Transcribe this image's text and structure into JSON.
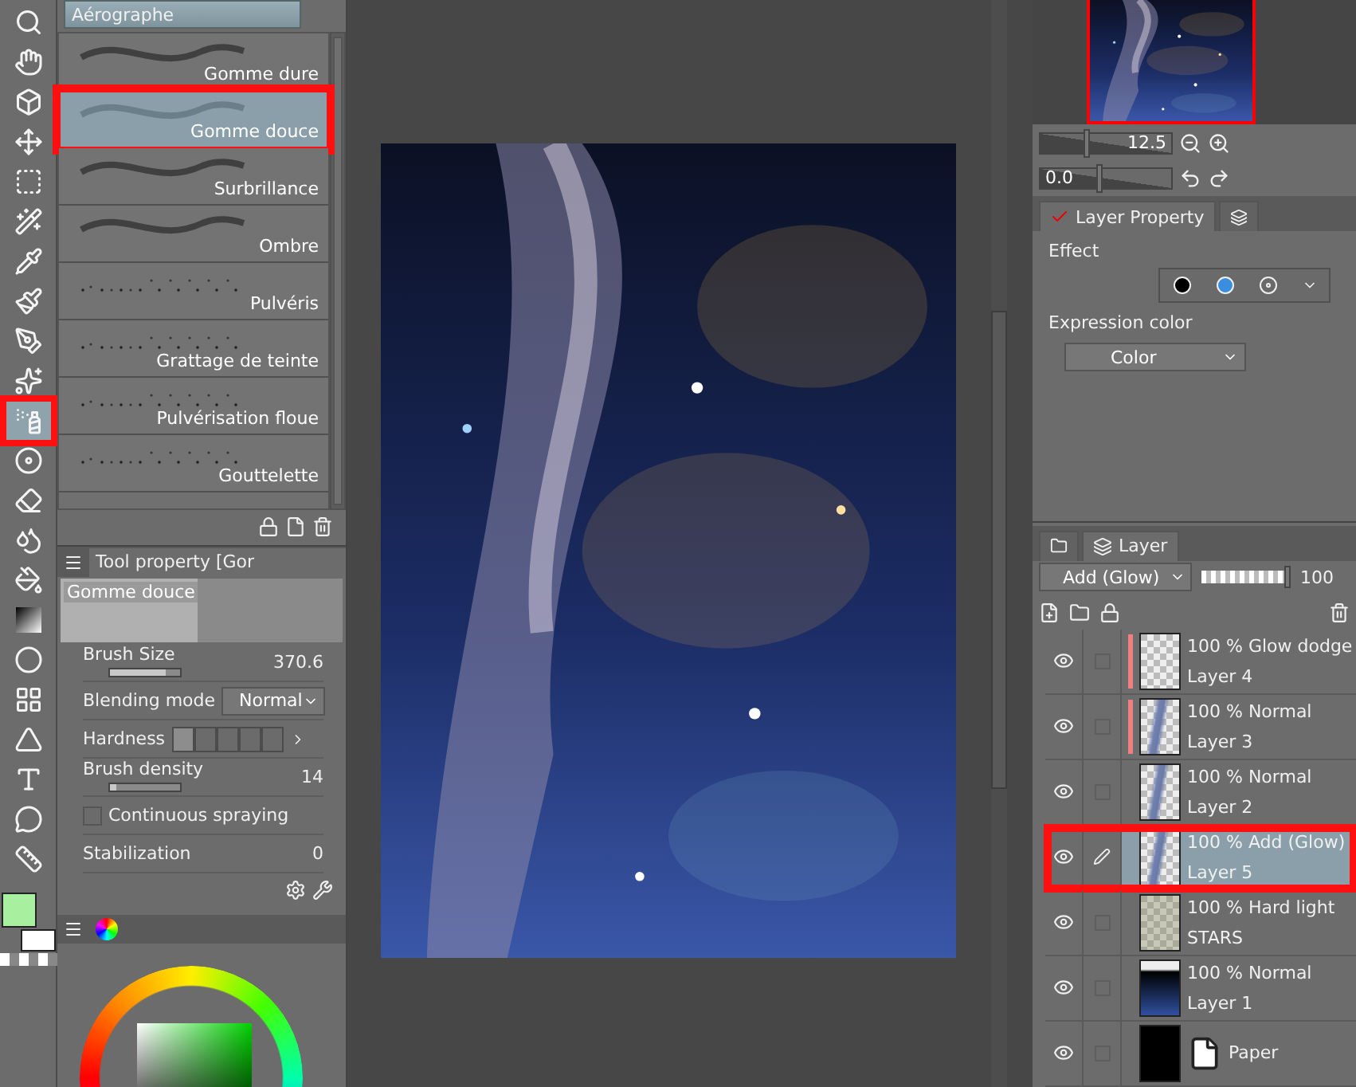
{
  "tools": [
    {
      "kind": "zoom",
      "selected": false
    },
    {
      "kind": "hand",
      "selected": false
    },
    {
      "kind": "object",
      "selected": false
    },
    {
      "kind": "move",
      "selected": false
    },
    {
      "kind": "select",
      "selected": false
    },
    {
      "kind": "wand",
      "selected": false
    },
    {
      "kind": "pipette",
      "selected": false
    },
    {
      "kind": "brush",
      "selected": false
    },
    {
      "kind": "pen",
      "selected": false
    },
    {
      "kind": "decoration",
      "selected": false
    },
    {
      "kind": "airbrush",
      "selected": true
    },
    {
      "kind": "disc",
      "selected": false
    },
    {
      "kind": "eraser",
      "selected": false
    },
    {
      "kind": "blend",
      "selected": false
    },
    {
      "kind": "fill",
      "selected": false
    },
    {
      "kind": "gradient",
      "selected": false
    },
    {
      "kind": "ellipse",
      "selected": false
    },
    {
      "kind": "frame",
      "selected": false
    },
    {
      "kind": "ruler",
      "selected": false
    },
    {
      "kind": "text",
      "selected": false
    },
    {
      "kind": "balloon",
      "selected": false
    },
    {
      "kind": "correction",
      "selected": false
    }
  ],
  "brush_group": "Aérographe",
  "brushes": [
    {
      "name": "Gomme dure",
      "kind": "stroke",
      "selected": false
    },
    {
      "name": "Gomme douce",
      "kind": "soft",
      "selected": true
    },
    {
      "name": "Surbrillance",
      "kind": "stroke",
      "selected": false
    },
    {
      "name": "Ombre",
      "kind": "stroke",
      "selected": false
    },
    {
      "name": "Pulvéris",
      "kind": "spray",
      "selected": false
    },
    {
      "name": "Grattage de teinte",
      "kind": "spray",
      "selected": false
    },
    {
      "name": "Pulvérisation floue",
      "kind": "spray",
      "selected": false
    },
    {
      "name": "Gouttelette",
      "kind": "spray",
      "selected": false
    }
  ],
  "tool_property": {
    "title": "Tool property [Gor",
    "brush_name": "Gomme douce",
    "settings": [
      {
        "kind": "slider",
        "label": "Brush Size",
        "value": "370.6",
        "level": 0.8
      },
      {
        "kind": "dropdown",
        "label": "Blending mode",
        "value": "Normal"
      },
      {
        "kind": "hardness",
        "label": "Hardness",
        "steps": [
          {
            "selected": true
          },
          {
            "selected": false
          },
          {
            "selected": false
          },
          {
            "selected": false
          },
          {
            "selected": false
          }
        ]
      },
      {
        "kind": "slider",
        "label": "Brush density",
        "value": "14",
        "level": 0.1
      },
      {
        "kind": "checkbox",
        "label": "Continuous spraying",
        "checked": false
      },
      {
        "kind": "value",
        "label": "Stabilization",
        "value": "0"
      }
    ]
  },
  "navigator": {
    "zoom": {
      "value": "12.5",
      "level": 0.35
    },
    "rotation": {
      "value": "0.0",
      "level": 0.45
    }
  },
  "layer_property": {
    "tab": "Layer Property",
    "effect_label": "Effect",
    "expression_label": "Expression color",
    "expression_value": "Color"
  },
  "layer_panel": {
    "tab": "Layer",
    "blend_mode": "Add (Glow)",
    "opacity": {
      "value": "100",
      "level": 1
    },
    "layers": [
      {
        "mode": "100 % Glow dodge",
        "name": "Layer 4",
        "kind": "clear",
        "visible": true,
        "clipped": true,
        "selected": false
      },
      {
        "mode": "100 % Normal",
        "name": "Layer 3",
        "kind": "streak",
        "visible": true,
        "clipped": true,
        "selected": false
      },
      {
        "mode": "100 % Normal",
        "name": "Layer 2",
        "kind": "streak",
        "visible": true,
        "clipped": false,
        "selected": false
      },
      {
        "mode": "100 % Add (Glow)",
        "name": "Layer 5",
        "kind": "streak",
        "visible": true,
        "clipped": false,
        "selected": true
      },
      {
        "mode": "100 % Hard light",
        "name": "STARS",
        "kind": "stars",
        "visible": true,
        "clipped": false,
        "selected": false
      },
      {
        "mode": "100 % Normal",
        "name": "Layer 1",
        "kind": "gradient",
        "visible": true,
        "clipped": false,
        "selected": false
      },
      {
        "name": "Paper",
        "kind": "paper",
        "visible": true,
        "clipped": false,
        "selected": false
      }
    ]
  }
}
